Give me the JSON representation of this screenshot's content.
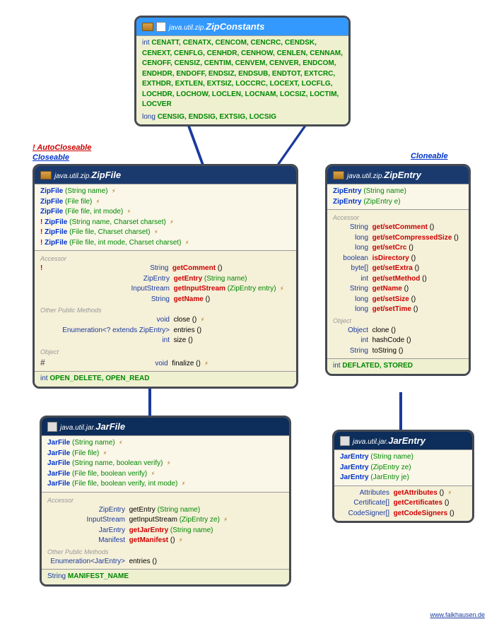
{
  "interfaces": {
    "autocloseable": "AutoCloseable",
    "closeable": "Closeable",
    "cloneable": "Cloneable"
  },
  "zipconstants": {
    "pkg": "java.util.zip.",
    "name": "ZipConstants",
    "int_prefix": "int",
    "int_consts": "CENATT, CENATX, CENCOM, CENCRC, CENDSK, CENEXT, CENFLG, CENHDR, CENHOW, CENLEN, CENNAM, CENOFF, CENSIZ, CENTIM, CENVEM, CENVER, ENDCOM, ENDHDR, ENDOFF, ENDSIZ, ENDSUB, ENDTOT, EXTCRC, EXTHDR, EXTLEN, EXTSIZ, LOCCRC, LOCEXT, LOCFLG, LOCHDR, LOCHOW, LOCLEN, LOCNAM, LOCSIZ, LOCTIM, LOCVER",
    "long_prefix": "long",
    "long_consts": "CENSIG, ENDSIG, EXTSIG, LOCSIG"
  },
  "zipfile": {
    "pkg": "java.util.zip.",
    "name": "ZipFile",
    "ctors": [
      {
        "excl": "",
        "name": "ZipFile",
        "params": "(String name)",
        "t": " ⚡"
      },
      {
        "excl": "",
        "name": "ZipFile",
        "params": "(File file)",
        "t": " ⚡"
      },
      {
        "excl": "",
        "name": "ZipFile",
        "params": "(File file, int mode)",
        "t": " ⚡"
      },
      {
        "excl": "! ",
        "name": "ZipFile",
        "params": "(String name, Charset charset)",
        "t": " ⚡"
      },
      {
        "excl": "! ",
        "name": "ZipFile",
        "params": "(File file, Charset charset)",
        "t": " ⚡"
      },
      {
        "excl": "! ",
        "name": "ZipFile",
        "params": "(File file, int mode, Charset charset)",
        "t": " ⚡"
      }
    ],
    "accessor_label": "Accessor",
    "accessors": [
      {
        "excl": "!",
        "ret": "String",
        "name": "getComment",
        "params": "()"
      },
      {
        "excl": "",
        "ret": "ZipEntry",
        "name": "getEntry",
        "params": "(String name)"
      },
      {
        "excl": "",
        "ret": "InputStream",
        "name": "getInputStream",
        "params": "(ZipEntry entry)",
        "t": " ⚡"
      },
      {
        "excl": "",
        "ret": "String",
        "name": "getName",
        "params": "()"
      }
    ],
    "other_label": "Other Public Methods",
    "others": [
      {
        "ret": "void",
        "name": "close",
        "params": "()",
        "t": " ⚡"
      },
      {
        "ret": "Enumeration<? extends ZipEntry>",
        "name": "entries",
        "params": "()"
      },
      {
        "ret": "int",
        "name": "size",
        "params": "()"
      }
    ],
    "object_label": "Object",
    "objects": [
      {
        "hash": "#",
        "ret": "void",
        "name": "finalize",
        "params": "()",
        "t": " ⚡"
      }
    ],
    "static_prefix": "int",
    "static_consts": "OPEN_DELETE, OPEN_READ"
  },
  "zipentry": {
    "pkg": "java.util.zip.",
    "name": "ZipEntry",
    "ctors": [
      {
        "name": "ZipEntry",
        "params": "(String name)"
      },
      {
        "name": "ZipEntry",
        "params": "(ZipEntry e)"
      }
    ],
    "accessor_label": "Accessor",
    "accessors": [
      {
        "ret": "String",
        "name": "get/setComment",
        "params": "()"
      },
      {
        "ret": "long",
        "name": "get/setCompressedSize",
        "params": "()"
      },
      {
        "ret": "long",
        "name": "get/setCrc",
        "params": "()"
      },
      {
        "ret": "boolean",
        "name": "isDirectory",
        "params": "()"
      },
      {
        "ret": "byte[]",
        "name": "get/setExtra",
        "params": "()"
      },
      {
        "ret": "int",
        "name": "get/setMethod",
        "params": "()"
      },
      {
        "ret": "String",
        "name": "getName",
        "params": "()"
      },
      {
        "ret": "long",
        "name": "get/setSize",
        "params": "()"
      },
      {
        "ret": "long",
        "name": "get/setTime",
        "params": "()"
      }
    ],
    "object_label": "Object",
    "objects": [
      {
        "ret": "Object",
        "name": "clone",
        "params": "()"
      },
      {
        "ret": "int",
        "name": "hashCode",
        "params": "()"
      },
      {
        "ret": "String",
        "name": "toString",
        "params": "()"
      }
    ],
    "static_prefix": "int",
    "static_consts": "DEFLATED, STORED"
  },
  "jarfile": {
    "pkg": "java.util.jar.",
    "name": "JarFile",
    "ctors": [
      {
        "name": "JarFile",
        "params": "(String name)",
        "t": " ⚡"
      },
      {
        "name": "JarFile",
        "params": "(File file)",
        "t": " ⚡"
      },
      {
        "name": "JarFile",
        "params": "(String name, boolean verify)",
        "t": " ⚡"
      },
      {
        "name": "JarFile",
        "params": "(File file, boolean verify)",
        "t": " ⚡"
      },
      {
        "name": "JarFile",
        "params": "(File file, boolean verify, int mode)",
        "t": " ⚡"
      }
    ],
    "accessor_label": "Accessor",
    "accessors": [
      {
        "ret": "ZipEntry",
        "name": "getEntry",
        "params": "(String name)"
      },
      {
        "ret": "InputStream",
        "name": "getInputStream",
        "params": "(ZipEntry ze)",
        "t": " ⚡"
      },
      {
        "ret": "JarEntry",
        "name": "getJarEntry",
        "params": "(String name)"
      },
      {
        "ret": "Manifest",
        "name": "getManifest",
        "params": "()",
        "t": " ⚡"
      }
    ],
    "other_label": "Other Public Methods",
    "others": [
      {
        "ret": "Enumeration<JarEntry>",
        "name": "entries",
        "params": "()"
      }
    ],
    "static_prefix": "String",
    "static_consts": "MANIFEST_NAME"
  },
  "jarentry": {
    "pkg": "java.util.jar.",
    "name": "JarEntry",
    "ctors": [
      {
        "name": "JarEntry",
        "params": "(String name)"
      },
      {
        "name": "JarEntry",
        "params": "(ZipEntry ze)"
      },
      {
        "name": "JarEntry",
        "params": "(JarEntry je)"
      }
    ],
    "methods": [
      {
        "ret": "Attributes",
        "name": "getAttributes",
        "params": "()",
        "t": " ⚡"
      },
      {
        "ret": "Certificate[]",
        "name": "getCertificates",
        "params": "()"
      },
      {
        "ret": "CodeSigner[]",
        "name": "getCodeSigners",
        "params": "()"
      }
    ]
  },
  "footer": "www.falkhausen.de"
}
